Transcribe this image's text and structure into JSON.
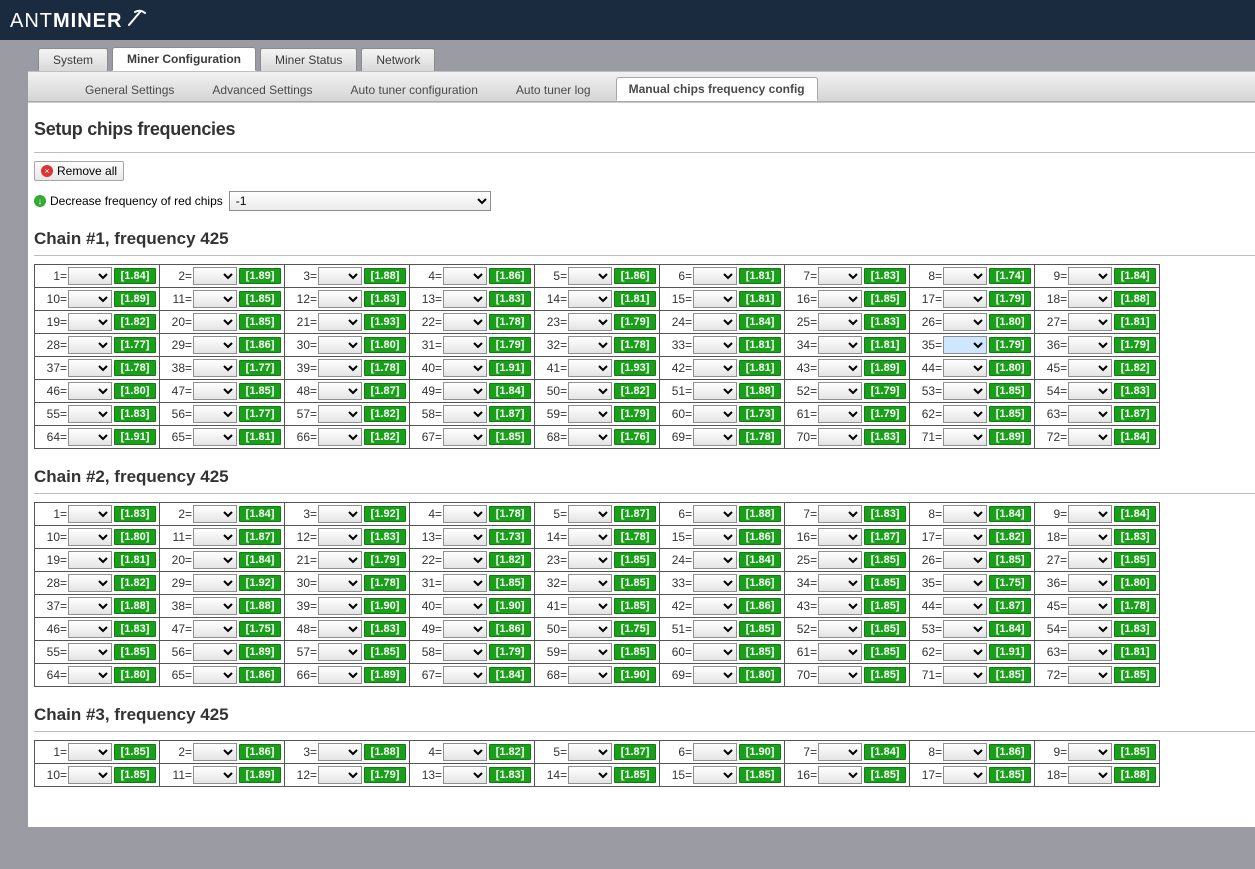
{
  "logo": {
    "prefix": "ANT",
    "suffix": "MINER"
  },
  "main_tabs": [
    {
      "label": "System",
      "active": false
    },
    {
      "label": "Miner Configuration",
      "active": true
    },
    {
      "label": "Miner Status",
      "active": false
    },
    {
      "label": "Network",
      "active": false
    }
  ],
  "sub_tabs": [
    {
      "label": "General Settings",
      "active": false
    },
    {
      "label": "Advanced Settings",
      "active": false
    },
    {
      "label": "Auto tuner configuration",
      "active": false
    },
    {
      "label": "Auto tuner log",
      "active": false
    },
    {
      "label": "Manual chips frequency config",
      "active": true
    }
  ],
  "page_title": "Setup chips frequencies",
  "remove_all_label": "Remove all",
  "decrease_label": "Decrease frequency of red chips",
  "decrease_value": "-1",
  "highlight_chain": 1,
  "highlight_chip": 35,
  "chains": [
    {
      "name": "Chain #1, frequency 425",
      "chips": [
        "1.84",
        "1.89",
        "1.88",
        "1.86",
        "1.86",
        "1.81",
        "1.83",
        "1.74",
        "1.84",
        "1.89",
        "1.85",
        "1.83",
        "1.83",
        "1.81",
        "1.81",
        "1.85",
        "1.79",
        "1.88",
        "1.82",
        "1.85",
        "1.93",
        "1.78",
        "1.79",
        "1.84",
        "1.83",
        "1.80",
        "1.81",
        "1.77",
        "1.86",
        "1.80",
        "1.79",
        "1.78",
        "1.81",
        "1.81",
        "1.79",
        "1.79",
        "1.78",
        "1.77",
        "1.78",
        "1.91",
        "1.93",
        "1.81",
        "1.89",
        "1.80",
        "1.82",
        "1.80",
        "1.85",
        "1.87",
        "1.84",
        "1.82",
        "1.88",
        "1.79",
        "1.85",
        "1.83",
        "1.83",
        "1.77",
        "1.82",
        "1.87",
        "1.79",
        "1.73",
        "1.79",
        "1.85",
        "1.87",
        "1.91",
        "1.81",
        "1.82",
        "1.85",
        "1.76",
        "1.78",
        "1.83",
        "1.89",
        "1.84"
      ]
    },
    {
      "name": "Chain #2, frequency 425",
      "chips": [
        "1.83",
        "1.84",
        "1.92",
        "1.78",
        "1.87",
        "1.88",
        "1.83",
        "1.84",
        "1.84",
        "1.80",
        "1.87",
        "1.83",
        "1.73",
        "1.78",
        "1.86",
        "1.87",
        "1.82",
        "1.83",
        "1.81",
        "1.84",
        "1.79",
        "1.82",
        "1.85",
        "1.84",
        "1.85",
        "1.85",
        "1.85",
        "1.82",
        "1.92",
        "1.78",
        "1.85",
        "1.85",
        "1.86",
        "1.85",
        "1.75",
        "1.80",
        "1.88",
        "1.88",
        "1.90",
        "1.90",
        "1.85",
        "1.86",
        "1.85",
        "1.87",
        "1.78",
        "1.83",
        "1.75",
        "1.83",
        "1.86",
        "1.75",
        "1.85",
        "1.85",
        "1.84",
        "1.83",
        "1.85",
        "1.89",
        "1.85",
        "1.79",
        "1.85",
        "1.85",
        "1.85",
        "1.91",
        "1.81",
        "1.80",
        "1.86",
        "1.89",
        "1.84",
        "1.90",
        "1.80",
        "1.85",
        "1.85",
        "1.85"
      ]
    },
    {
      "name": "Chain #3, frequency 425",
      "chips": [
        "1.85",
        "1.86",
        "1.88",
        "1.82",
        "1.87",
        "1.90",
        "1.84",
        "1.86",
        "1.85",
        "1.85",
        "1.89",
        "1.79",
        "1.83",
        "1.85",
        "1.85",
        "1.85",
        "1.85",
        "1.88"
      ]
    }
  ]
}
